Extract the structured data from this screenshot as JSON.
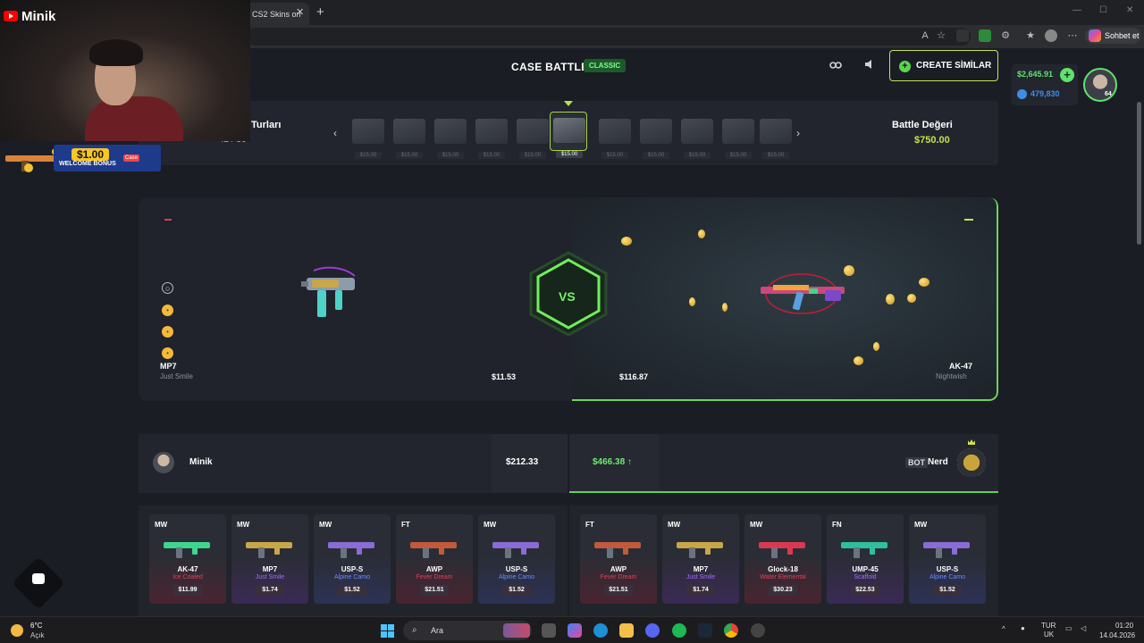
{
  "browser": {
    "tab_title": "CS2 Skins on",
    "tab_close": "✕",
    "new_tab": "+",
    "copilot_label": "Sohbet et",
    "window_controls": [
      "—",
      "☐",
      "✕"
    ]
  },
  "header": {
    "title": "CASE BATTLE",
    "mode_badge": "CLASSIC",
    "create_label": "CREATE SİMİLAR",
    "link_icon": "link-icon",
    "sound_icon": "speaker-icon"
  },
  "wallet": {
    "balance": "$2,645.91",
    "coins": "479,830",
    "level": "64"
  },
  "rounds": {
    "label": "Turları",
    "sub": "42 / 50",
    "prev": "‹",
    "next": "›",
    "cases": [
      {
        "price": "$15.00",
        "active": false
      },
      {
        "price": "$15.00",
        "active": false
      },
      {
        "price": "$15.00",
        "active": false
      },
      {
        "price": "$15.00",
        "active": false
      },
      {
        "price": "$15.00",
        "active": false
      },
      {
        "price": "$15.00",
        "active": true
      },
      {
        "price": "$15.00",
        "active": false
      },
      {
        "price": "$15.00",
        "active": false
      },
      {
        "price": "$15.00",
        "active": false
      },
      {
        "price": "$15.00",
        "active": false
      },
      {
        "price": "$15.00",
        "active": false
      }
    ],
    "battle_value_label": "Battle Değeri",
    "battle_value": "$750.00"
  },
  "arena": {
    "vs": "VS",
    "left": {
      "name": "MP7",
      "skin": "Just Smile",
      "value": "$11.53"
    },
    "right": {
      "name": "AK-47",
      "skin": "Nightwish",
      "value": "$116.87"
    },
    "emojis": [
      "☺",
      "•",
      "•",
      "•"
    ]
  },
  "players": {
    "p1": {
      "name": "Minik",
      "total": "$212.33"
    },
    "p2": {
      "bot_tag": "BOT",
      "name": "Nerd",
      "total": "$466.38 ↑"
    }
  },
  "items_left": [
    {
      "cond": "MW",
      "name": "AK-47",
      "skin": "Ice Coaled",
      "price": "$11.99",
      "tint": "#4a2430",
      "skin_color": "#e0405a",
      "gun_color": "#3dd68c"
    },
    {
      "cond": "MW",
      "name": "MP7",
      "skin": "Just Smile",
      "price": "$1.74",
      "tint": "#3a2a55",
      "skin_color": "#a66cff",
      "gun_color": "#c9a64a"
    },
    {
      "cond": "MW",
      "name": "USP-S",
      "skin": "Alpine Camo",
      "price": "$1.52",
      "tint": "#2c3255",
      "skin_color": "#6c8cff",
      "gun_color": "#8a6cd8"
    },
    {
      "cond": "FT",
      "name": "AWP",
      "skin": "Fever Dream",
      "price": "$21.51",
      "tint": "#4a2430",
      "skin_color": "#e0405a",
      "gun_color": "#c25a3c"
    },
    {
      "cond": "MW",
      "name": "USP-S",
      "skin": "Alpine Camo",
      "price": "$1.52",
      "tint": "#2c3255",
      "skin_color": "#6c8cff",
      "gun_color": "#8a6cd8"
    }
  ],
  "items_right": [
    {
      "cond": "FT",
      "name": "AWP",
      "skin": "Fever Dream",
      "price": "$21.51",
      "tint": "#4a2430",
      "skin_color": "#e0405a",
      "gun_color": "#c25a3c"
    },
    {
      "cond": "MW",
      "name": "MP7",
      "skin": "Just Smile",
      "price": "$1.74",
      "tint": "#3a2a55",
      "skin_color": "#a66cff",
      "gun_color": "#c9a64a"
    },
    {
      "cond": "MW",
      "name": "Glock-18",
      "skin": "Water Elemental",
      "price": "$30.23",
      "tint": "#4a2430",
      "skin_color": "#e0405a",
      "gun_color": "#d9394f"
    },
    {
      "cond": "FN",
      "name": "UMP-45",
      "skin": "Scaffold",
      "price": "$22.53",
      "tint": "#3a2a55",
      "skin_color": "#a66cff",
      "gun_color": "#2fbfa0"
    },
    {
      "cond": "MW",
      "name": "USP-S",
      "skin": "Alpine Camo",
      "price": "$1.52",
      "tint": "#2c3255",
      "skin_color": "#6c8cff",
      "gun_color": "#8a6cd8"
    }
  ],
  "webcam": {
    "channel": "Minik"
  },
  "promo": {
    "amount": "$1.00",
    "text": "WELCOME BONUS",
    "brand": "Case"
  },
  "taskbar": {
    "temp": "6°C",
    "condition": "Açık",
    "search": "Ara",
    "lang1": "TUR",
    "lang2": "UK",
    "time": "01:20",
    "date": "14.04.2026"
  }
}
